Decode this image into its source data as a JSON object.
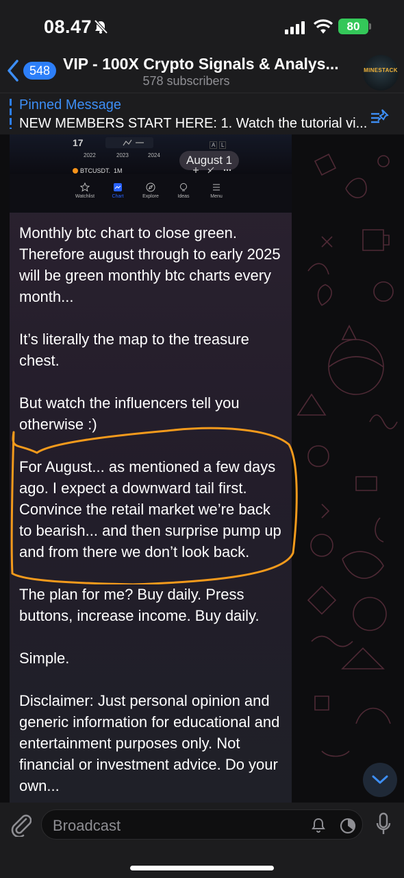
{
  "status_bar": {
    "time": "08.47",
    "battery": "80"
  },
  "header": {
    "back_badge": "548",
    "title": "VIP - 100X Crypto Signals & Analys...",
    "subtitle": "578 subscribers",
    "avatar_text": "MINESTACK"
  },
  "pinned": {
    "title": "Pinned Message",
    "text": "NEW MEMBERS START HERE: 1. Watch the tutorial vi..."
  },
  "chart_preview": {
    "tv_logo": "17",
    "years": [
      "2022",
      "2023",
      "2024"
    ],
    "ticker": "BTCUSDT.",
    "interval": "1M",
    "date_pill": "August 1",
    "nav": [
      "Watchlist",
      "Chart",
      "Explore",
      "Ideas",
      "Menu"
    ],
    "chart_btns": [
      "A",
      "L"
    ]
  },
  "message": {
    "paragraphs": [
      "Monthly btc chart to close green. Therefore august through to early 2025 will be green monthly btc charts every month...",
      "It’s literally the map to the treasure chest.",
      "But watch the influencers tell you otherwise :)",
      "For August... as mentioned a few days ago. I expect a downward tail first. Convince the retail market we’re back to bearish... and then surprise pump up and from there we don’t look back.",
      "The plan for me? Buy daily. Press buttons, increase income. Buy daily.",
      "Simple.",
      "Disclaimer: Just personal opinion and generic information for educational and entertainment purposes only. Not financial or investment advice. Do your own..."
    ]
  },
  "composer": {
    "placeholder": "Broadcast"
  },
  "colors": {
    "accent": "#2d7ff9",
    "highlight_stroke": "#f39a1c",
    "battery": "#34c759"
  }
}
